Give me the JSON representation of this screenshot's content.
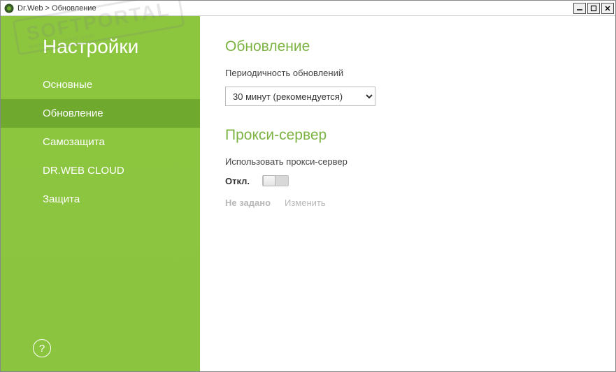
{
  "titlebar": {
    "app_name": "Dr.Web",
    "separator": ">",
    "page": "Обновление"
  },
  "watermark": {
    "text": "SOFTPORTAL",
    "sub": "www.softportal.com"
  },
  "sidebar": {
    "title": "Настройки",
    "items": [
      {
        "label": "Основные",
        "active": false
      },
      {
        "label": "Обновление",
        "active": true
      },
      {
        "label": "Самозащита",
        "active": false
      },
      {
        "label": "DR.WEB CLOUD",
        "active": false
      },
      {
        "label": "Защита",
        "active": false
      }
    ],
    "help_symbol": "?"
  },
  "main": {
    "update": {
      "title": "Обновление",
      "frequency_label": "Периодичность обновлений",
      "frequency_value": "30 минут (рекомендуется)"
    },
    "proxy": {
      "title": "Прокси-сервер",
      "use_label": "Использовать прокси-сервер",
      "toggle_state_label": "Откл.",
      "status_text": "Не задано",
      "change_label": "Изменить"
    }
  }
}
